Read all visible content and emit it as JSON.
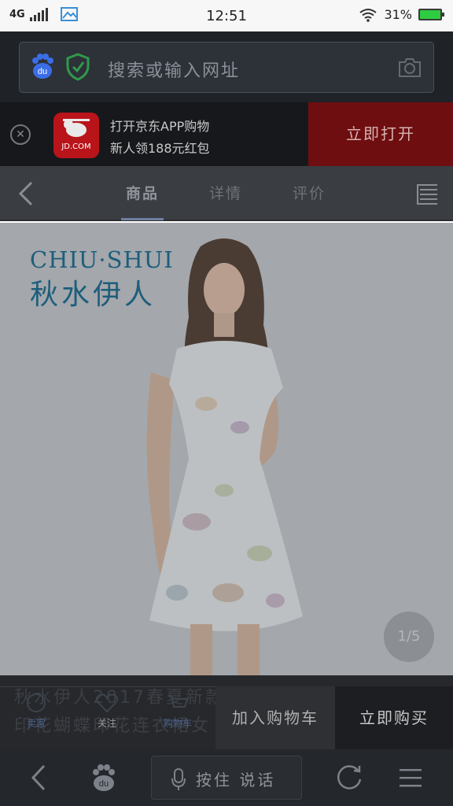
{
  "status_bar": {
    "network": "4G",
    "time": "12:51",
    "battery": "31%",
    "colors": {
      "battery": "#2ecc40"
    }
  },
  "address_bar": {
    "placeholder": "搜索或输入网址",
    "icons": [
      "baidu-paw-icon",
      "secure-shield-icon",
      "camera-icon"
    ]
  },
  "app_banner": {
    "logo_text": "JD.COM",
    "line1": "打开京东APP购物",
    "line2": "新人领188元红包",
    "open_button": "立即打开",
    "colors": {
      "logo_bg": "#b8141a",
      "button_bg": "#6e0e10"
    }
  },
  "product_nav": {
    "tabs": [
      {
        "label": "商品",
        "active": true
      },
      {
        "label": "详情",
        "active": false
      },
      {
        "label": "评价",
        "active": false
      }
    ]
  },
  "hero": {
    "brand_en": "CHIU·SHUI",
    "brand_cn": "秋水伊人",
    "pager": "1/5"
  },
  "product": {
    "title_line1": "秋水伊人2017春夏新款",
    "title_line2": "印花蝴蝶印花连衣裙女"
  },
  "action_bar": {
    "store_label": "卖家",
    "follow_label": "关注",
    "cart_label": "购物车",
    "add_to_cart": "加入购物车",
    "buy_now": "立即购买"
  },
  "bottom_nav": {
    "voice_label": "按住 说话"
  }
}
